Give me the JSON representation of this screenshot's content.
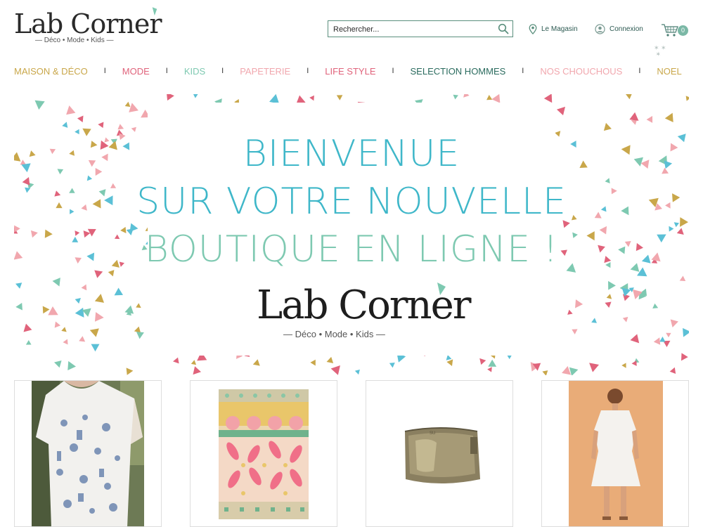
{
  "header": {
    "logo": {
      "wordmark": "Lab Corner",
      "tagline": "— Déco • Mode • Kids —"
    },
    "search": {
      "placeholder": "Rechercher..."
    },
    "store_link": "Le Magasin",
    "login_link": "Connexion",
    "cart_count": "0"
  },
  "nav": {
    "items": [
      {
        "label": "MAISON & DÉCO",
        "color": "#c9a74a"
      },
      {
        "label": "MODE",
        "color": "#e0637b"
      },
      {
        "label": "KIDS",
        "color": "#7ec9b1"
      },
      {
        "label": "PAPETERIE",
        "color": "#f1a7ae"
      },
      {
        "label": "LIFE STYLE",
        "color": "#e0637b"
      },
      {
        "label": "SELECTION HOMMES",
        "color": "#2a6b5e"
      },
      {
        "label": "NOS CHOUCHOUS",
        "color": "#f1a7ae"
      },
      {
        "label": "NOEL",
        "color": "#c9a74a"
      }
    ],
    "separator": "I"
  },
  "banner": {
    "line1": "BIENVENUE",
    "line2": "SUR VOTRE NOUVELLE",
    "line3": "BOUTIQUE EN LIGNE !",
    "logo_wordmark": "Lab Corner",
    "logo_tagline": "— Déco • Mode • Kids —",
    "colors": {
      "line1": "#3fb7c9",
      "line2": "#3fb7c9",
      "line3": "#7ec9b1"
    },
    "confetti_colors": [
      "#f1a7ae",
      "#7ec9b1",
      "#c9a74a",
      "#e0637b",
      "#5bc0d6"
    ]
  },
  "products": [
    {
      "name": "printed-tshirt"
    },
    {
      "name": "patterned-tea-towel"
    },
    {
      "name": "metallic-pouch"
    },
    {
      "name": "white-dress"
    }
  ]
}
